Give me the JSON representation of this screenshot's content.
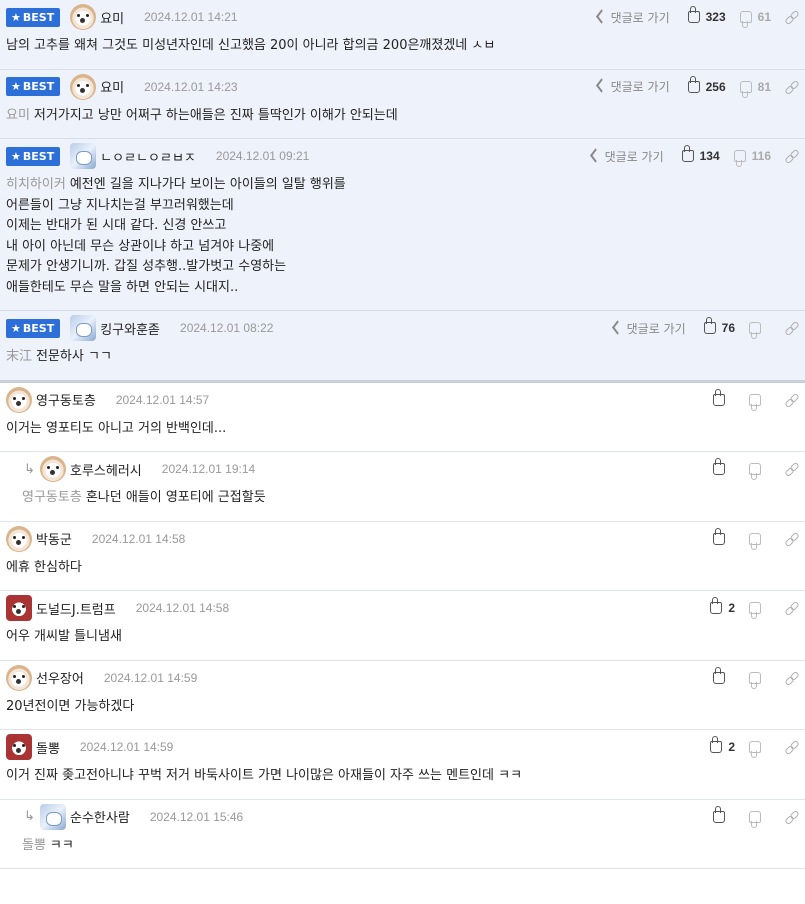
{
  "ui": {
    "best_label": "BEST",
    "reply_link": "댓글로 가기"
  },
  "comments": [
    {
      "best": true,
      "reply": false,
      "avatar": "dog-avatar-icon",
      "nick": "요미",
      "date": "2024.12.01 14:21",
      "mention": "",
      "lines": [
        "남의 고추를 왜쳐 그것도 미성년자인데 신고했음 20이 아니라 합의금 200은깨졌겠네 ㅅㅂ"
      ],
      "up": "323",
      "down": "61",
      "show_reply_link": true
    },
    {
      "best": true,
      "reply": false,
      "avatar": "dog-avatar-icon",
      "nick": "요미",
      "date": "2024.12.01 14:23",
      "mention": "요미",
      "lines": [
        "저거가지고 낭만 어쩌구 하는애들은 진짜 틀딱인가 이해가 안되는데"
      ],
      "up": "256",
      "down": "81",
      "show_reply_link": true
    },
    {
      "best": true,
      "reply": false,
      "avatar": "blue-avatar-icon",
      "nick": "ㄴㅇㄹㄴㅇㄹㅂㅈ",
      "date": "2024.12.01 09:21",
      "mention": "히치하이커",
      "lines": [
        "예전엔 길을 지나가다 보이는 아이들의 일탈 행위를",
        "어른들이 그냥 지나치는걸 부끄러워했는데",
        "이제는 반대가 된 시대 같다. 신경 안쓰고",
        "내 아이 아닌데 무슨 상관이냐 하고 넘겨야 나중에",
        "문제가 안생기니까. 갑질 성추행..발가벗고 수영하는",
        "애들한테도 무슨 말을 하면 안되는 시대지.."
      ],
      "up": "134",
      "down": "116",
      "show_reply_link": true
    },
    {
      "best": true,
      "reply": false,
      "avatar": "blue-avatar-icon",
      "nick": "킹구와훈졷",
      "date": "2024.12.01 08:22",
      "mention": "末江",
      "lines": [
        "전문하사 ㄱㄱ"
      ],
      "up": "76",
      "down": "",
      "show_reply_link": true
    },
    {
      "best": false,
      "reply": false,
      "avatar": "dog-avatar-icon",
      "nick": "영구동토층",
      "date": "2024.12.01 14:57",
      "mention": "",
      "lines": [
        "이거는 영포티도 아니고 거의 반백인데..."
      ],
      "up": "",
      "down": "",
      "show_reply_link": false
    },
    {
      "best": false,
      "reply": true,
      "avatar": "dog-avatar-icon",
      "nick": "호루스헤러시",
      "date": "2024.12.01 19:14",
      "mention": "영구동토층",
      "lines": [
        "혼나던 애들이 영포티에 근접할듯"
      ],
      "up": "",
      "down": "",
      "show_reply_link": false
    },
    {
      "best": false,
      "reply": false,
      "avatar": "dog-avatar-icon",
      "nick": "박동군",
      "date": "2024.12.01 14:58",
      "mention": "",
      "lines": [
        "에휴 한심하다"
      ],
      "up": "",
      "down": "",
      "show_reply_link": false
    },
    {
      "best": false,
      "reply": false,
      "avatar": "red-avatar-icon",
      "nick": "도널드J.트럼프",
      "date": "2024.12.01 14:58",
      "mention": "",
      "lines": [
        "어우 개씨발 틀니냄새"
      ],
      "up": "2",
      "down": "",
      "show_reply_link": false
    },
    {
      "best": false,
      "reply": false,
      "avatar": "dog-avatar-icon",
      "nick": "선우장어",
      "date": "2024.12.01 14:59",
      "mention": "",
      "lines": [
        "20년전이면 가능하겠다"
      ],
      "up": "",
      "down": "",
      "show_reply_link": false
    },
    {
      "best": false,
      "reply": false,
      "avatar": "red-avatar-icon",
      "nick": "돌뽕",
      "date": "2024.12.01 14:59",
      "mention": "",
      "lines": [
        "이거 진짜 좆고전아니냐 꾸벅 저거 바둑사이트 가면 나이많은 아재들이 자주 쓰는 멘트인데 ㅋㅋ"
      ],
      "up": "2",
      "down": "",
      "show_reply_link": false
    },
    {
      "best": false,
      "reply": true,
      "avatar": "blue-avatar-icon",
      "nick": "순수한사람",
      "date": "2024.12.01 15:46",
      "mention": "돌뽕",
      "lines": [
        "ㅋㅋ"
      ],
      "up": "",
      "down": "",
      "show_reply_link": false
    }
  ]
}
